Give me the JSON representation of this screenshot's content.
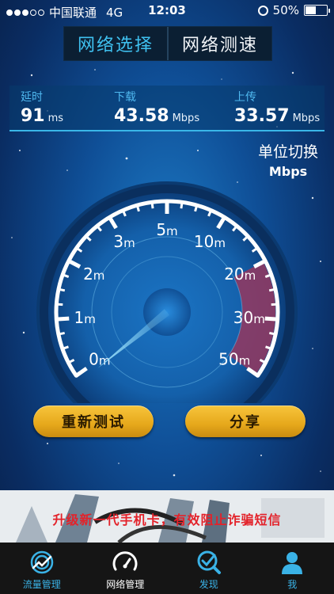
{
  "status_bar": {
    "carrier": "中国联通",
    "network": "4G",
    "time": "12:03",
    "battery": "50%",
    "battery_level": 0.5,
    "signal_strength": 3
  },
  "tabs": [
    {
      "label": "网络选择",
      "active": true
    },
    {
      "label": "网络测速",
      "active": false
    }
  ],
  "stats": {
    "latency": {
      "label": "延时",
      "value": "91",
      "unit": "ms"
    },
    "download": {
      "label": "下载",
      "value": "43.58",
      "unit": "Mbps"
    },
    "upload": {
      "label": "上传",
      "value": "33.57",
      "unit": "Mbps"
    }
  },
  "unit_switch": {
    "label": "单位切换",
    "value": "Mbps"
  },
  "gauge": {
    "scale_labels": [
      "0m",
      "1m",
      "2m",
      "3m",
      "5m",
      "10m",
      "20m",
      "30m",
      "50m"
    ],
    "needle_value": "0m",
    "highlight_range": [
      "20m",
      "50m"
    ],
    "accent_color": "#8e3a63"
  },
  "buttons": {
    "retest": "重新测试",
    "share": "分享"
  },
  "ad": {
    "text": "升级新一代手机卡，有效阻止诈骗短信"
  },
  "tabbar": [
    {
      "label": "流量管理",
      "icon": "data-usage-icon",
      "active": false
    },
    {
      "label": "网络管理",
      "icon": "speedometer-icon",
      "active": true
    },
    {
      "label": "发现",
      "icon": "discover-icon",
      "active": false
    },
    {
      "label": "我",
      "icon": "person-icon",
      "active": false
    }
  ]
}
